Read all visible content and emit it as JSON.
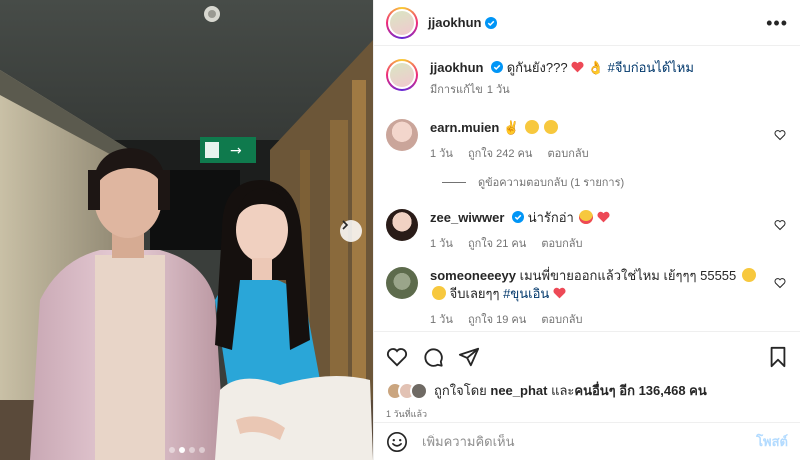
{
  "post": {
    "username": "jjaokhun",
    "photo_index": 2,
    "photo_count": 4,
    "exit_sign": "→"
  },
  "caption": {
    "username": "jjaokhun",
    "text": "ดูกันยัง???",
    "hashtag": "#จีบก่อนได้ไหม",
    "edited": "มีการแก้ไข",
    "time": "1 วัน"
  },
  "comments": [
    {
      "username": "earn.muien",
      "text": "",
      "time": "1 วัน",
      "likes": "ถูกใจ 242 คน",
      "reply": "ตอบกลับ",
      "view_replies": "ดูข้อความตอบกลับ (1 รายการ)"
    },
    {
      "username": "zee_wiwwer",
      "text": "น่ารักอ่า",
      "time": "1 วัน",
      "likes": "ถูกใจ 21 คน",
      "reply": "ตอบกลับ"
    },
    {
      "username": "someoneeeyy",
      "text": "เมนพี่ขายออกแล้วใช่ไหม เย้ๆๆๆ 55555",
      "text2": "จีบเลยๆๆ",
      "hashtag": "#ขุนเอิน",
      "time": "1 วัน",
      "likes": "ถูกใจ 19 คน",
      "reply": "ตอบกลับ"
    }
  ],
  "likes": {
    "prefix": "ถูกใจโดย",
    "user": "nee_phat",
    "middle": "และ",
    "others": "คนอื่นๆ อีก 136,468 คน"
  },
  "timestamp": "1 วันที่แล้ว",
  "add_comment": {
    "placeholder": "เพิ่มความคิดเห็น",
    "post_label": "โพสต์"
  },
  "colors": {
    "verified": "#0095f6",
    "heart_red": "#ed4956",
    "link_blue": "#00376b",
    "post_disabled": "#b3dbff"
  },
  "icons": [
    "more-icon",
    "heart-icon",
    "comment-icon",
    "share-icon",
    "bookmark-icon",
    "emoji-icon",
    "verified-icon",
    "chevron-right-icon"
  ]
}
